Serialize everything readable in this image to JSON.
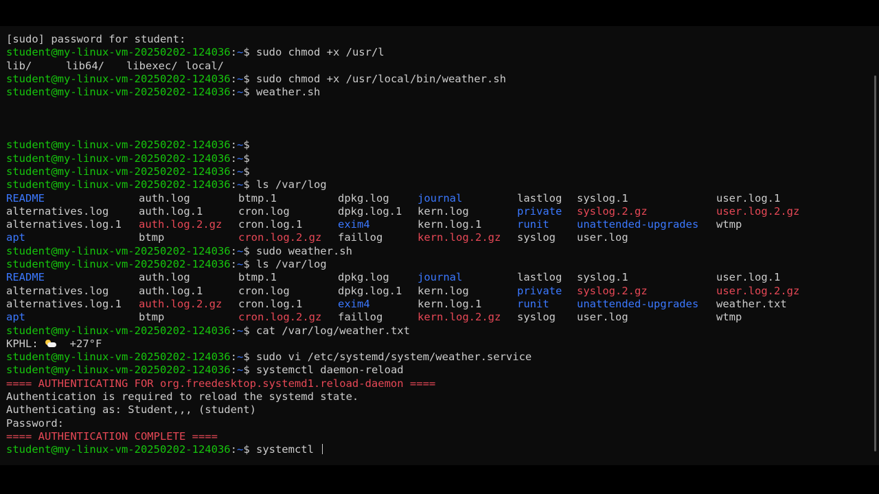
{
  "terminal": {
    "prompt_user": "student@my-linux-vm-20250202-124036",
    "prompt_sep": ":",
    "prompt_path": "~",
    "prompt_symbol": "$ ",
    "sudo_password": "[sudo] password for student:",
    "cmd_chmod_partial": "sudo chmod +x /usr/l",
    "tab_completion": [
      "lib/",
      "lib64/",
      "libexec/",
      "local/"
    ],
    "cmd_chmod_full": "sudo chmod +x /usr/local/bin/weather.sh",
    "cmd_weather": "weather.sh",
    "cmd_ls": "ls /var/log",
    "cmd_sudo_weather": "sudo weather.sh",
    "ls_output_1": [
      [
        {
          "t": "README",
          "c": "blue"
        },
        {
          "t": "auth.log",
          "c": ""
        },
        {
          "t": "btmp.1",
          "c": ""
        },
        {
          "t": "dpkg.log",
          "c": ""
        },
        {
          "t": "journal",
          "c": "blue"
        },
        {
          "t": "lastlog",
          "c": ""
        },
        {
          "t": "syslog.1",
          "c": ""
        },
        {
          "t": "user.log.1",
          "c": ""
        }
      ],
      [
        {
          "t": "alternatives.log",
          "c": ""
        },
        {
          "t": "auth.log.1",
          "c": ""
        },
        {
          "t": "cron.log",
          "c": ""
        },
        {
          "t": "dpkg.log.1",
          "c": ""
        },
        {
          "t": "kern.log",
          "c": ""
        },
        {
          "t": "private",
          "c": "blue"
        },
        {
          "t": "syslog.2.gz",
          "c": "red"
        },
        {
          "t": "user.log.2.gz",
          "c": "red"
        }
      ],
      [
        {
          "t": "alternatives.log.1",
          "c": ""
        },
        {
          "t": "auth.log.2.gz",
          "c": "red"
        },
        {
          "t": "cron.log.1",
          "c": ""
        },
        {
          "t": "exim4",
          "c": "blue"
        },
        {
          "t": "kern.log.1",
          "c": ""
        },
        {
          "t": "runit",
          "c": "blue"
        },
        {
          "t": "unattended-upgrades",
          "c": "blue"
        },
        {
          "t": "wtmp",
          "c": ""
        }
      ],
      [
        {
          "t": "apt",
          "c": "blue"
        },
        {
          "t": "btmp",
          "c": ""
        },
        {
          "t": "cron.log.2.gz",
          "c": "red"
        },
        {
          "t": "faillog",
          "c": ""
        },
        {
          "t": "kern.log.2.gz",
          "c": "red"
        },
        {
          "t": "syslog",
          "c": ""
        },
        {
          "t": "user.log",
          "c": ""
        },
        {
          "t": "",
          "c": ""
        }
      ]
    ],
    "ls_output_2": [
      [
        {
          "t": "README",
          "c": "blue"
        },
        {
          "t": "auth.log",
          "c": ""
        },
        {
          "t": "btmp.1",
          "c": ""
        },
        {
          "t": "dpkg.log",
          "c": ""
        },
        {
          "t": "journal",
          "c": "blue"
        },
        {
          "t": "lastlog",
          "c": ""
        },
        {
          "t": "syslog.1",
          "c": ""
        },
        {
          "t": "user.log.1",
          "c": ""
        }
      ],
      [
        {
          "t": "alternatives.log",
          "c": ""
        },
        {
          "t": "auth.log.1",
          "c": ""
        },
        {
          "t": "cron.log",
          "c": ""
        },
        {
          "t": "dpkg.log.1",
          "c": ""
        },
        {
          "t": "kern.log",
          "c": ""
        },
        {
          "t": "private",
          "c": "blue"
        },
        {
          "t": "syslog.2.gz",
          "c": "red"
        },
        {
          "t": "user.log.2.gz",
          "c": "red"
        }
      ],
      [
        {
          "t": "alternatives.log.1",
          "c": ""
        },
        {
          "t": "auth.log.2.gz",
          "c": "red"
        },
        {
          "t": "cron.log.1",
          "c": ""
        },
        {
          "t": "exim4",
          "c": "blue"
        },
        {
          "t": "kern.log.1",
          "c": ""
        },
        {
          "t": "runit",
          "c": "blue"
        },
        {
          "t": "unattended-upgrades",
          "c": "blue"
        },
        {
          "t": "weather.txt",
          "c": ""
        }
      ],
      [
        {
          "t": "apt",
          "c": "blue"
        },
        {
          "t": "btmp",
          "c": ""
        },
        {
          "t": "cron.log.2.gz",
          "c": "red"
        },
        {
          "t": "faillog",
          "c": ""
        },
        {
          "t": "kern.log.2.gz",
          "c": "red"
        },
        {
          "t": "syslog",
          "c": ""
        },
        {
          "t": "user.log",
          "c": ""
        },
        {
          "t": "wtmp",
          "c": ""
        }
      ]
    ],
    "cmd_cat": "cat /var/log/weather.txt",
    "weather_station": "KPHL: ",
    "weather_icon": "sun-behind-cloud-icon",
    "weather_temp": "+27°F",
    "cmd_vi": "sudo vi /etc/systemd/system/weather.service",
    "cmd_reload": "systemctl daemon-reload",
    "auth_header": "==== AUTHENTICATING FOR org.freedesktop.systemd1.reload-daemon ====",
    "auth_required": "Authentication is required to reload the systemd state.",
    "auth_as": "Authenticating as: Student,,, (student)",
    "password_prompt": "Password:",
    "auth_complete": "==== AUTHENTICATION COMPLETE ====",
    "cmd_current": "systemctl "
  },
  "colors": {
    "background": "#0c0c0c",
    "foreground": "#cccccc",
    "prompt_green": "#16c60c",
    "path_blue": "#3b78ff",
    "error_red": "#e74856"
  }
}
